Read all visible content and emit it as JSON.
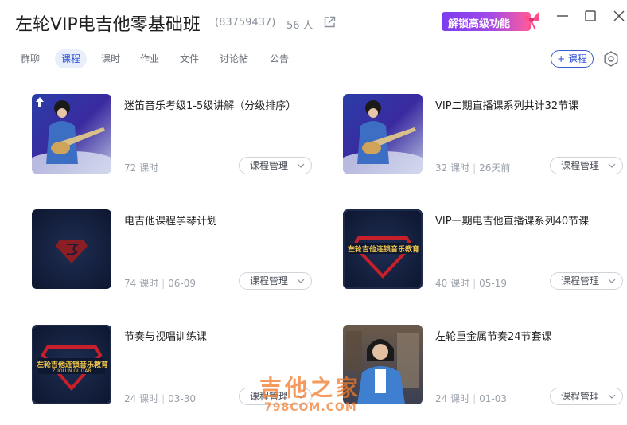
{
  "header": {
    "title": "左轮VIP电吉他零基础班",
    "group_id": "(83759437)",
    "member_count": "56 人",
    "unlock_label": "解锁高级功能"
  },
  "tabs": [
    "群聊",
    "课程",
    "课时",
    "作业",
    "文件",
    "讨论帖",
    "公告"
  ],
  "active_tab": "课程",
  "actions": {
    "add_course_label": "+ 课程"
  },
  "manage_label": "课程管理",
  "courses": [
    {
      "title": "迷笛音乐考级1-5级讲解（分级排序）",
      "lessons": "72 课时",
      "date": "",
      "thumb": "guitarist-stage",
      "pinned": true
    },
    {
      "title": "VIP二期直播课系列共计32节课",
      "lessons": "32 课时",
      "date": "26天前",
      "thumb": "guitarist-stage",
      "pinned": false
    },
    {
      "title": "电吉他课程学琴计划",
      "lessons": "74 课时",
      "date": "06-09",
      "thumb": "superman-logo",
      "pinned": false
    },
    {
      "title": "VIP一期电吉他直播课系列40节课",
      "lessons": "40 课时",
      "date": "05-19",
      "thumb": "school-logo",
      "pinned": false
    },
    {
      "title": "节奏与视唱训练课",
      "lessons": "24 课时",
      "date": "03-30",
      "thumb": "school-logo",
      "pinned": false
    },
    {
      "title": "左轮重金属节奏24节套课",
      "lessons": "24 课时",
      "date": "01-03",
      "thumb": "teacher-photo",
      "pinned": false
    }
  ],
  "logo_text": {
    "cn": "左轮吉他连锁音乐教育",
    "en": "ZUOLUN GUITAR"
  },
  "watermark": {
    "cn": "吉他之家",
    "en": "798COM.COM"
  },
  "colors": {
    "accent": "#2a4fd6",
    "tab_active_bg": "#e9eefb",
    "muted": "#9aa0aa"
  }
}
